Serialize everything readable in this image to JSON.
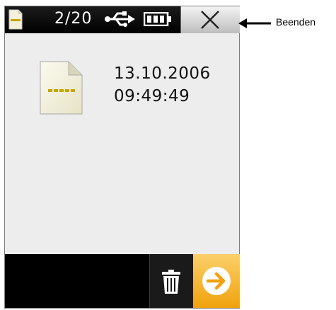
{
  "header": {
    "counter": "2/20",
    "icons": [
      "file-icon",
      "usb-icon",
      "battery-icon",
      "close-icon"
    ]
  },
  "file": {
    "date": "13.10.2006",
    "time": "09:49:49",
    "icon": "file-icon"
  },
  "footer": {
    "icons": [
      "trash-icon",
      "arrow-right-icon"
    ]
  },
  "annotation": {
    "label": "Beenden"
  },
  "colors": {
    "topbar": "#000000",
    "screen_background": "#ededed",
    "accent": "#f0a20d",
    "file_stripe": "#c8a600"
  }
}
